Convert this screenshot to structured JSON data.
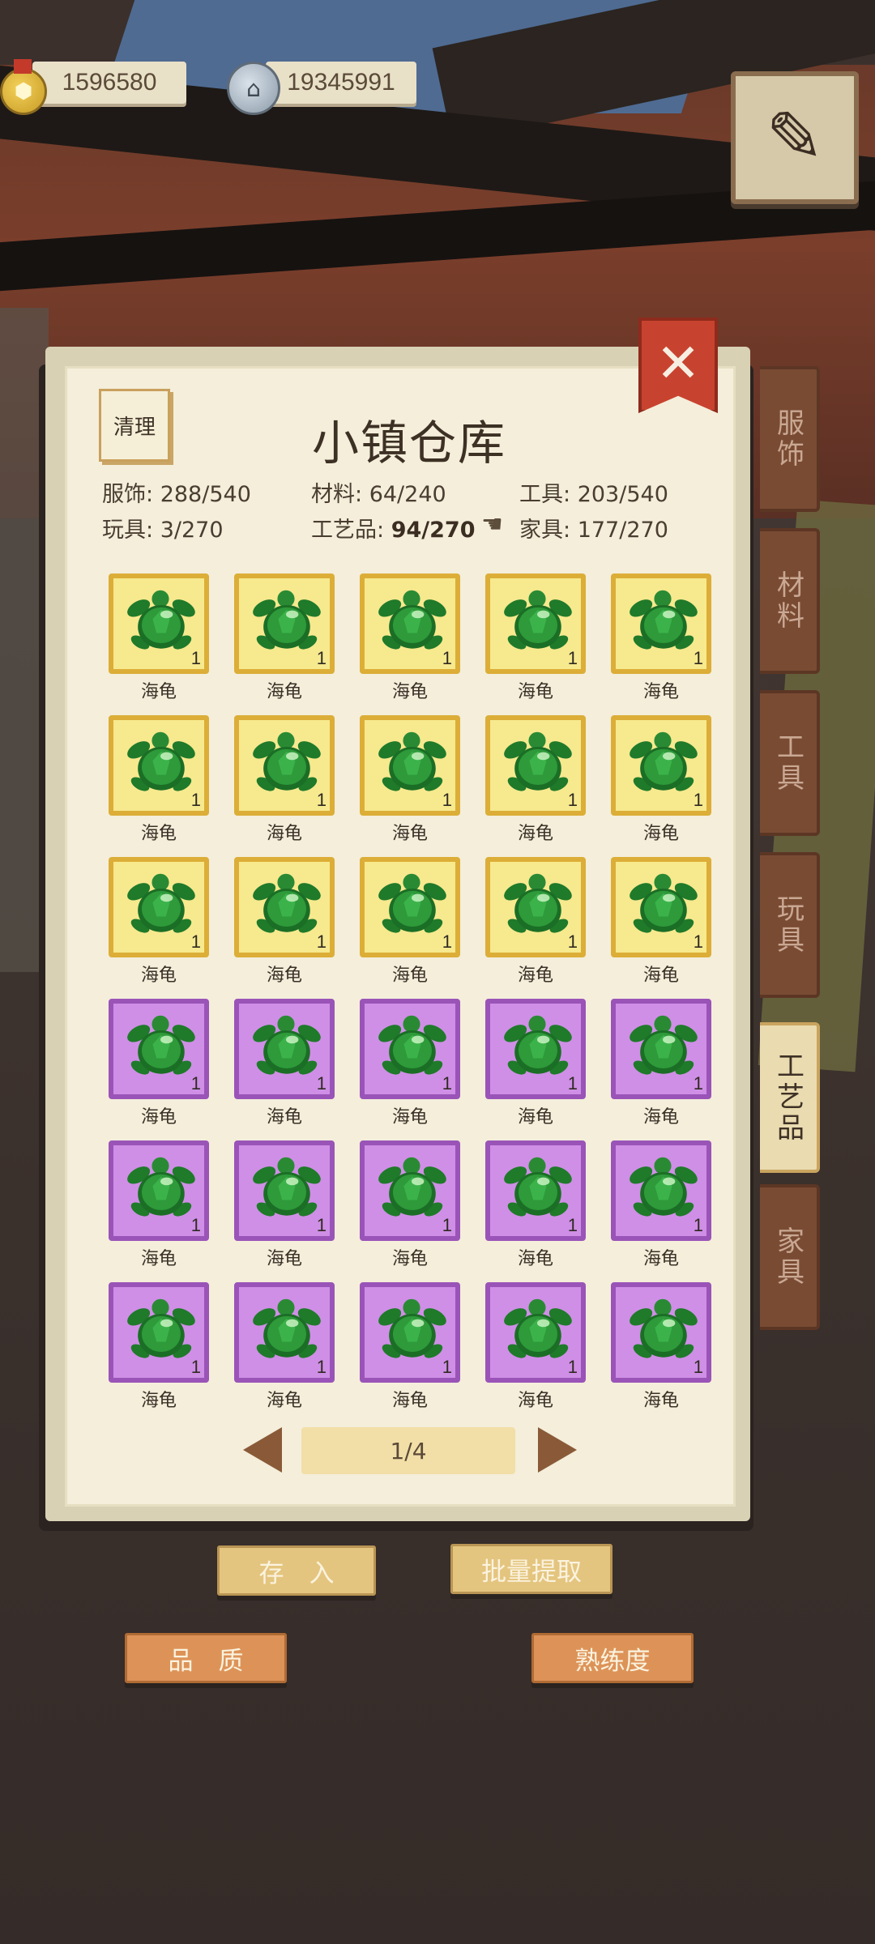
{
  "currencies": [
    {
      "icon": "gold-coin-icon",
      "value": "1596580"
    },
    {
      "icon": "silver-coin-icon",
      "value": "19345991"
    }
  ],
  "panel": {
    "title": "小镇仓库",
    "clear_label": "清理"
  },
  "stats": [
    {
      "label": "服饰:",
      "value": "288/540"
    },
    {
      "label": "材料:",
      "value": "64/240"
    },
    {
      "label": "工具:",
      "value": "203/540"
    },
    {
      "label": "玩具:",
      "value": "3/270"
    },
    {
      "label": "工艺品:",
      "value": "94/270"
    },
    {
      "label": "家具:",
      "value": "177/270"
    }
  ],
  "items": [
    {
      "name": "海龟",
      "count": "1",
      "rarity": "gold"
    },
    {
      "name": "海龟",
      "count": "1",
      "rarity": "gold"
    },
    {
      "name": "海龟",
      "count": "1",
      "rarity": "gold"
    },
    {
      "name": "海龟",
      "count": "1",
      "rarity": "gold"
    },
    {
      "name": "海龟",
      "count": "1",
      "rarity": "gold"
    },
    {
      "name": "海龟",
      "count": "1",
      "rarity": "gold"
    },
    {
      "name": "海龟",
      "count": "1",
      "rarity": "gold"
    },
    {
      "name": "海龟",
      "count": "1",
      "rarity": "gold"
    },
    {
      "name": "海龟",
      "count": "1",
      "rarity": "gold"
    },
    {
      "name": "海龟",
      "count": "1",
      "rarity": "gold"
    },
    {
      "name": "海龟",
      "count": "1",
      "rarity": "gold"
    },
    {
      "name": "海龟",
      "count": "1",
      "rarity": "gold"
    },
    {
      "name": "海龟",
      "count": "1",
      "rarity": "gold"
    },
    {
      "name": "海龟",
      "count": "1",
      "rarity": "gold"
    },
    {
      "name": "海龟",
      "count": "1",
      "rarity": "gold"
    },
    {
      "name": "海龟",
      "count": "1",
      "rarity": "purple"
    },
    {
      "name": "海龟",
      "count": "1",
      "rarity": "purple"
    },
    {
      "name": "海龟",
      "count": "1",
      "rarity": "purple"
    },
    {
      "name": "海龟",
      "count": "1",
      "rarity": "purple"
    },
    {
      "name": "海龟",
      "count": "1",
      "rarity": "purple"
    },
    {
      "name": "海龟",
      "count": "1",
      "rarity": "purple"
    },
    {
      "name": "海龟",
      "count": "1",
      "rarity": "purple"
    },
    {
      "name": "海龟",
      "count": "1",
      "rarity": "purple"
    },
    {
      "name": "海龟",
      "count": "1",
      "rarity": "purple"
    },
    {
      "name": "海龟",
      "count": "1",
      "rarity": "purple"
    },
    {
      "name": "海龟",
      "count": "1",
      "rarity": "purple"
    },
    {
      "name": "海龟",
      "count": "1",
      "rarity": "purple"
    },
    {
      "name": "海龟",
      "count": "1",
      "rarity": "purple"
    },
    {
      "name": "海龟",
      "count": "1",
      "rarity": "purple"
    },
    {
      "name": "海龟",
      "count": "1",
      "rarity": "purple"
    }
  ],
  "pagination": {
    "label": "1/4"
  },
  "tabs": [
    {
      "label": "服饰",
      "active": false
    },
    {
      "label": "材料",
      "active": false
    },
    {
      "label": "工具",
      "active": false
    },
    {
      "label": "玩具",
      "active": false
    },
    {
      "label": "工艺品",
      "active": true
    },
    {
      "label": "家具",
      "active": false
    }
  ],
  "buttons": {
    "deposit": "存　入",
    "batch_extract": "批量提取",
    "quality": "品　质",
    "proficiency": "熟练度"
  },
  "colors": {
    "gold_tile": "#f7e98e",
    "purple_tile": "#cf8fe6",
    "tab_active": "#eadbb0",
    "tab_inactive": "#7a4b33"
  }
}
